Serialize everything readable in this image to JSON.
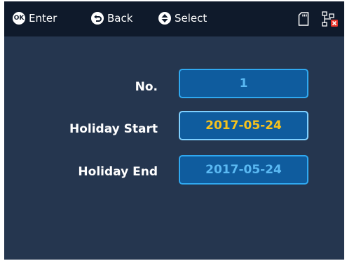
{
  "hints": {
    "enter": {
      "badge": "OK",
      "label": "Enter"
    },
    "back": {
      "label": "Back"
    },
    "select": {
      "label": "Select"
    }
  },
  "status_icons": [
    "sd-card-icon",
    "network-disconnected-icon"
  ],
  "form": {
    "no": {
      "label": "No.",
      "value": "1"
    },
    "holiday_start": {
      "label": "Holiday Start",
      "value": "2017-05-24",
      "focused": true
    },
    "holiday_end": {
      "label": "Holiday End",
      "value": "2017-05-24"
    }
  },
  "colors": {
    "background": "#25364f",
    "topbar": "#0f1a2b",
    "field_border": "#2fa8f0",
    "field_fill": "#0f5c9e",
    "field_text": "#5ab9f3",
    "focus_text": "#f6c21d",
    "error_red": "#e8342a"
  }
}
